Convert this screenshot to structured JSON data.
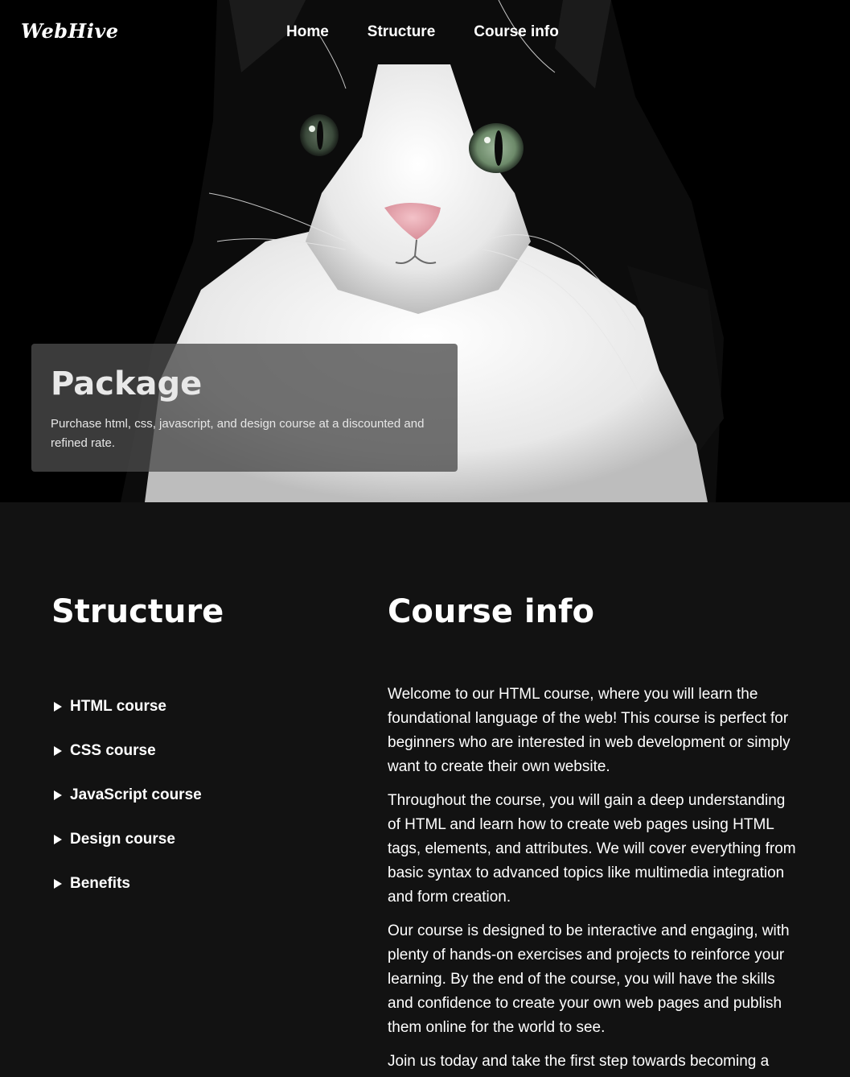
{
  "nav": {
    "logo": "WebHive",
    "links": [
      "Home",
      "Structure",
      "Course info"
    ]
  },
  "hero": {
    "image": "cat-photo",
    "package_title": "Package",
    "package_text": "Purchase html, css, javascript, and design course at a discounted and refined rate."
  },
  "structure": {
    "heading": "Structure",
    "items": [
      "HTML course",
      "CSS course",
      "JavaScript course",
      "Design course",
      "Benefits"
    ]
  },
  "course_info": {
    "heading": "Course info",
    "paragraphs": [
      "Welcome to our HTML course, where you will learn the foundational language of the web! This course is perfect for beginners who are interested in web development or simply want to create their own website.",
      "Throughout the course, you will gain a deep understanding of HTML and learn how to create web pages using HTML tags, elements, and attributes. We will cover everything from basic syntax to advanced topics like multimedia integration and form creation.",
      "Our course is designed to be interactive and engaging, with plenty of hands-on exercises and projects to reinforce your learning. By the end of the course, you will have the skills and confidence to create your own web pages and publish them online for the world to see.",
      "Join us today and take the first step towards becoming a skilled web developer!"
    ]
  },
  "colors": {
    "background": "#121212",
    "text": "#ffffff",
    "card": "#4b4b4b"
  }
}
